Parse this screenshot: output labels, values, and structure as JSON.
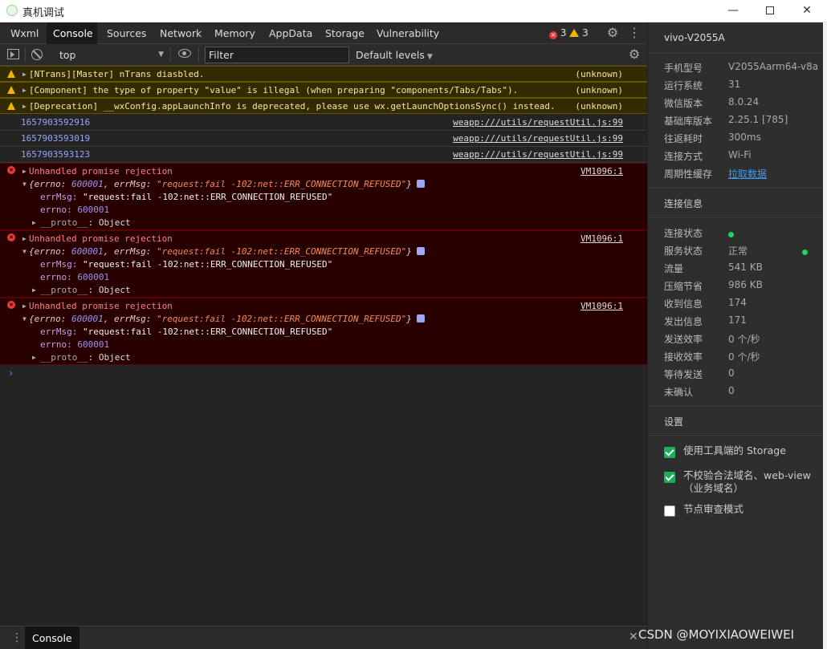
{
  "window": {
    "title": "真机调试",
    "min_glyph": "—",
    "close_glyph": "✕"
  },
  "tabs": [
    {
      "label": "Wxml"
    },
    {
      "label": "Console"
    },
    {
      "label": "Sources"
    },
    {
      "label": "Network"
    },
    {
      "label": "Memory"
    },
    {
      "label": "AppData"
    },
    {
      "label": "Storage"
    },
    {
      "label": "Vulnerability"
    }
  ],
  "indicators": {
    "errors": "3",
    "warnings": "3"
  },
  "toolbar": {
    "context": "top",
    "filter_placeholder": "Filter",
    "levels": "Default levels"
  },
  "icons": {
    "gear": "⚙",
    "more_vert": "⋮",
    "caret_down": "▼",
    "expand_right": "▶",
    "expand_down": "▼",
    "close": "✕",
    "prompt": "›",
    "error_x": "×"
  },
  "warnings": [
    {
      "text": "[NTrans][Master] nTrans diasbled.",
      "source": "(unknown)"
    },
    {
      "text": "[Component] the type of property \"value\" is illegal (when preparing \"components/Tabs/Tabs\").",
      "source": "(unknown)"
    },
    {
      "text": "[Deprecation] __wxConfig.appLaunchInfo is deprecated, please use wx.getLaunchOptionsSync() instead.",
      "source": "(unknown)"
    }
  ],
  "logs": [
    {
      "text": "1657903592916",
      "source": "weapp:///utils/requestUtil.js:99"
    },
    {
      "text": "1657903593019",
      "source": "weapp:///utils/requestUtil.js:99"
    },
    {
      "text": "1657903593123",
      "source": "weapp:///utils/requestUtil.js:99"
    }
  ],
  "error": {
    "title": "Unhandled promise rejection",
    "source": "VM1096:1",
    "obj_open": "{",
    "obj_errno_key": "errno: ",
    "obj_errno": "600001",
    "obj_sep": ", ",
    "obj_msg_key": "errMsg: ",
    "obj_msg": "\"request:fail -102:net::ERR_CONNECTION_REFUSED\"",
    "obj_close": "}",
    "prop_msg_key": "errMsg: ",
    "prop_msg": "\"request:fail -102:net::ERR_CONNECTION_REFUSED\"",
    "prop_errno_key": "errno: ",
    "prop_errno": "600001",
    "proto_key": "__proto__",
    "proto_val": ": Object"
  },
  "drawer": {
    "tab": "Console"
  },
  "panel": {
    "device": "vivo-V2055A",
    "info": [
      {
        "k": "手机型号",
        "v": "V2055Aarm64-v8a"
      },
      {
        "k": "运行系统",
        "v": "31"
      },
      {
        "k": "微信版本",
        "v": "8.0.24"
      },
      {
        "k": "基础库版本",
        "v": "2.25.1 [785]"
      },
      {
        "k": "往返耗时",
        "v": "300ms"
      },
      {
        "k": "连接方式",
        "v": "Wi-Fi"
      },
      {
        "k": "周期性缓存",
        "v": "拉取数据"
      }
    ],
    "conn_title": "连接信息",
    "conn": [
      {
        "k": "连接状态",
        "v": ""
      },
      {
        "k": "服务状态",
        "v": "正常"
      },
      {
        "k": "流量",
        "v": "541 KB"
      },
      {
        "k": "压缩节省",
        "v": "986 KB"
      },
      {
        "k": "收到信息",
        "v": "174"
      },
      {
        "k": "发出信息",
        "v": "171"
      },
      {
        "k": "发送效率",
        "v": "0 个/秒"
      },
      {
        "k": "接收效率",
        "v": "0 个/秒"
      },
      {
        "k": "等待发送",
        "v": "0"
      },
      {
        "k": "未确认",
        "v": "0"
      }
    ],
    "settings_title": "设置",
    "settings": [
      {
        "label": "使用工具端的 Storage",
        "checked": true
      },
      {
        "label": "不校验合法域名、web-view（业务域名）",
        "checked": true
      },
      {
        "label": "节点审查模式",
        "checked": false
      }
    ]
  },
  "watermark": "CSDN @MOYIXIAOWEIWEI",
  "colors": {
    "accent_green": "#1aad5a",
    "link_blue": "#3b9cf5",
    "error_red": "#e53935",
    "warn_yellow": "#f0b400"
  }
}
